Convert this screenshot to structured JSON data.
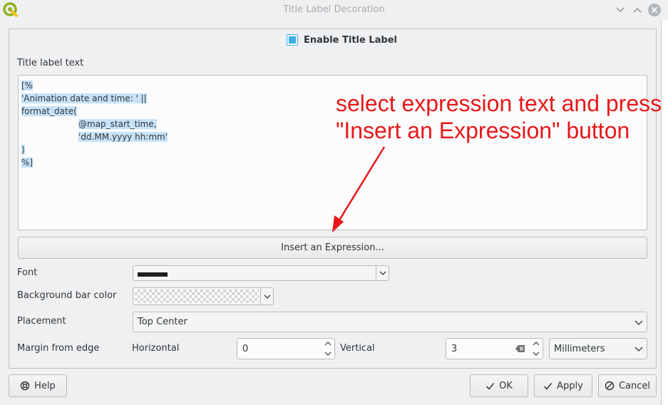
{
  "window": {
    "title": "Title Label Decoration"
  },
  "enable": {
    "label": "Enable Title Label",
    "checked": true
  },
  "title_text": {
    "label": "Title label text",
    "lines": [
      "[%",
      "'Animation date and time: ' ||",
      "format_date(",
      "@map_start_time,",
      "'dd.MM.yyyy hh:mm'",
      ")",
      "%]"
    ]
  },
  "insert_button": {
    "label": "Insert an Expression..."
  },
  "font": {
    "label": "Font"
  },
  "background_bar": {
    "label": "Background bar color"
  },
  "placement": {
    "label": "Placement",
    "value": "Top Center"
  },
  "margin": {
    "label": "Margin from edge",
    "horizontal_label": "Horizontal",
    "horizontal_value": "0",
    "vertical_label": "Vertical",
    "vertical_value": "3",
    "units_value": "Millimeters"
  },
  "buttons": {
    "help": "Help",
    "ok": "OK",
    "apply": "Apply",
    "cancel": "Cancel"
  },
  "annotation": {
    "line1": "select expression text and press",
    "line2": "\"Insert an Expression\" button",
    "color": "#e8181a"
  },
  "colors": {
    "accent": "#3daee9",
    "selection": "#c6e2f7"
  }
}
